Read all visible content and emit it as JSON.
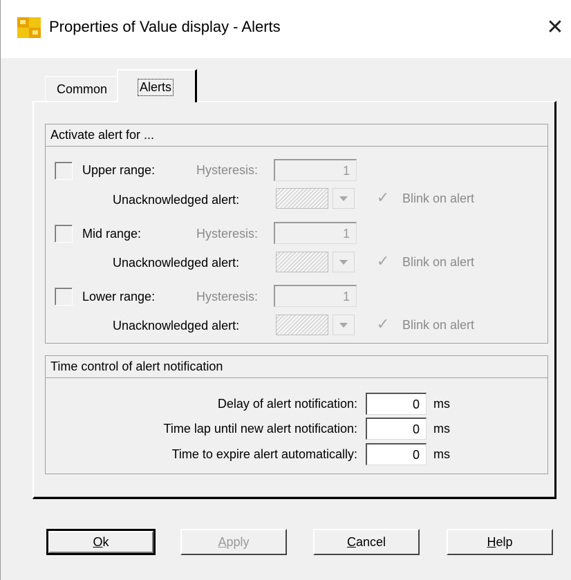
{
  "window": {
    "title": "Properties of Value display - Alerts"
  },
  "tabs": [
    {
      "label": "Common"
    },
    {
      "label": "Alerts"
    }
  ],
  "alerts_group": {
    "title": "Activate alert for ...",
    "hysteresis_label": "Hysteresis:",
    "unack_label": "Unacknowledged alert:",
    "blink_label": "Blink on alert",
    "rows": [
      {
        "label": "Upper range:",
        "hysteresis": "1",
        "checked": false,
        "blink_checked": true
      },
      {
        "label": "Mid range:",
        "hysteresis": "1",
        "checked": false,
        "blink_checked": true
      },
      {
        "label": "Lower range:",
        "hysteresis": "1",
        "checked": false,
        "blink_checked": true
      }
    ]
  },
  "time_group": {
    "title": "Time control of alert notification",
    "unit": "ms",
    "rows": [
      {
        "label": "Delay of alert notification:",
        "value": "0"
      },
      {
        "label": "Time lap until new alert notification:",
        "value": "0"
      },
      {
        "label": "Time to expire alert automatically:",
        "value": "0"
      }
    ]
  },
  "buttons": {
    "ok": {
      "mnemonic": "O",
      "rest": "k"
    },
    "apply": {
      "mnemonic": "A",
      "rest": "pply"
    },
    "cancel": {
      "mnemonic": "C",
      "rest": "ancel"
    },
    "help": {
      "mnemonic": "H",
      "rest": "elp"
    }
  },
  "icons": {
    "app": "app-icon",
    "close": "close-icon",
    "blink_check": "check-icon",
    "dropdown": "chevron-down-icon"
  }
}
